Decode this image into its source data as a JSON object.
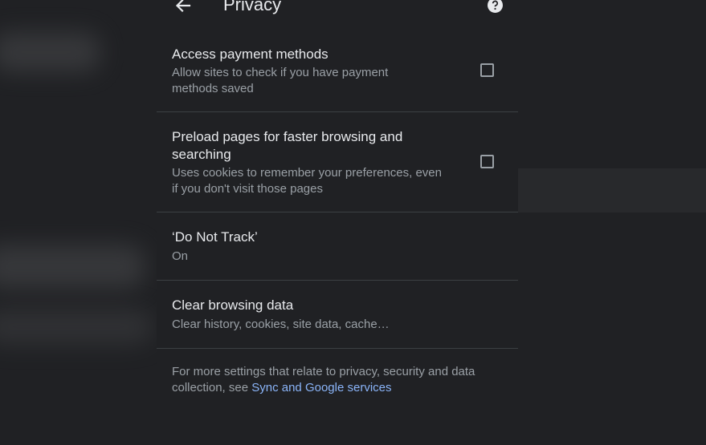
{
  "header": {
    "title": "Privacy",
    "back_icon": "arrow-left-icon",
    "help_icon": "help-circle-icon"
  },
  "settings": [
    {
      "title": "Access payment methods",
      "subtitle": "Allow sites to check if you have payment methods saved",
      "control": "checkbox",
      "checked": false
    },
    {
      "title": "Preload pages for faster browsing and searching",
      "subtitle": "Uses cookies to remember your preferences, even if you don't visit those pages",
      "control": "checkbox",
      "checked": false
    },
    {
      "title": "‘Do Not Track’",
      "subtitle": "On"
    },
    {
      "title": "Clear browsing data",
      "subtitle": "Clear history, cookies, site data, cache…"
    }
  ],
  "footer": {
    "text": "For more settings that relate to privacy, security and data collection, see ",
    "link_label": "Sync and Google services"
  },
  "colors": {
    "background": "#202124",
    "text_primary": "#e8eaed",
    "text_secondary": "#9aa0a6",
    "link": "#8ab4f8",
    "divider": "#3c4043"
  }
}
